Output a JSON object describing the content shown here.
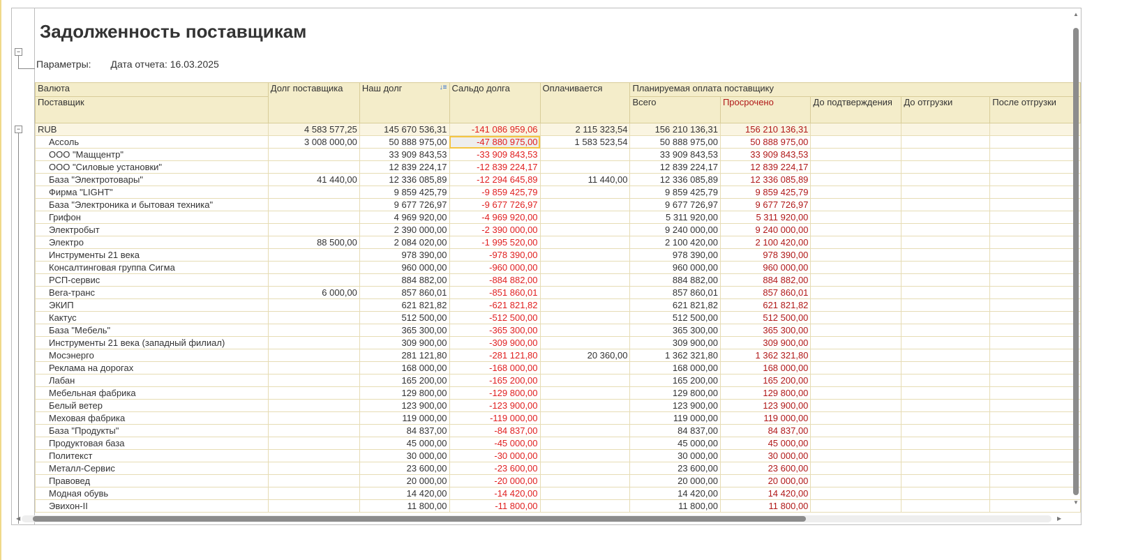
{
  "report": {
    "title": "Задолженность поставщикам",
    "params_label": "Параметры:",
    "params_value": "Дата отчета: 16.03.2025"
  },
  "headers": {
    "currency": "Валюта",
    "supplier": "Поставщик",
    "supplier_debt": "Долг поставщика",
    "our_debt": "Наш долг",
    "balance": "Сальдо долга",
    "paying": "Оплачивается",
    "planned": "Планируемая оплата поставщику",
    "total": "Всего",
    "overdue": "Просрочено",
    "before_confirm": "До подтверждения",
    "before_shipment": "До отгрузки",
    "after_shipment": "После отгрузки"
  },
  "group": {
    "name": "RUB",
    "supplier_debt": "4 583 577,25",
    "our_debt": "145 670 536,31",
    "balance": "-141 086 959,06",
    "paying": "2 115 323,54",
    "total": "156 210 136,31",
    "overdue": "156 210 136,31"
  },
  "rows": [
    [
      "Ассоль",
      "3 008 000,00",
      "50 888 975,00",
      "-47 880 975,00",
      "1 583 523,54",
      "50 888 975,00",
      "50 888 975,00"
    ],
    [
      "ООО \"Мащцентр\"",
      "",
      "33 909 843,53",
      "-33 909 843,53",
      "",
      "33 909 843,53",
      "33 909 843,53"
    ],
    [
      "ООО \"Силовые установки\"",
      "",
      "12 839 224,17",
      "-12 839 224,17",
      "",
      "12 839 224,17",
      "12 839 224,17"
    ],
    [
      "База \"Электротовары\"",
      "41 440,00",
      "12 336 085,89",
      "-12 294 645,89",
      "11 440,00",
      "12 336 085,89",
      "12 336 085,89"
    ],
    [
      "Фирма \"LIGHT\"",
      "",
      "9 859 425,79",
      "-9 859 425,79",
      "",
      "9 859 425,79",
      "9 859 425,79"
    ],
    [
      "База \"Электроника и бытовая техника\"",
      "",
      "9 677 726,97",
      "-9 677 726,97",
      "",
      "9 677 726,97",
      "9 677 726,97"
    ],
    [
      "Грифон",
      "",
      "4 969 920,00",
      "-4 969 920,00",
      "",
      "5 311 920,00",
      "5 311 920,00"
    ],
    [
      "Электробыт",
      "",
      "2 390 000,00",
      "-2 390 000,00",
      "",
      "9 240 000,00",
      "9 240 000,00"
    ],
    [
      "Электро",
      "88 500,00",
      "2 084 020,00",
      "-1 995 520,00",
      "",
      "2 100 420,00",
      "2 100 420,00"
    ],
    [
      "Инструменты 21 века",
      "",
      "978 390,00",
      "-978 390,00",
      "",
      "978 390,00",
      "978 390,00"
    ],
    [
      "Консалтинговая группа Сигма",
      "",
      "960 000,00",
      "-960 000,00",
      "",
      "960 000,00",
      "960 000,00"
    ],
    [
      "РСП-сервис",
      "",
      "884 882,00",
      "-884 882,00",
      "",
      "884 882,00",
      "884 882,00"
    ],
    [
      "Вега-транс",
      "6 000,00",
      "857 860,01",
      "-851 860,01",
      "",
      "857 860,01",
      "857 860,01"
    ],
    [
      "ЭКИП",
      "",
      "621 821,82",
      "-621 821,82",
      "",
      "621 821,82",
      "621 821,82"
    ],
    [
      "Кактус",
      "",
      "512 500,00",
      "-512 500,00",
      "",
      "512 500,00",
      "512 500,00"
    ],
    [
      "База \"Мебель\"",
      "",
      "365 300,00",
      "-365 300,00",
      "",
      "365 300,00",
      "365 300,00"
    ],
    [
      "Инструменты 21 века (западный филиал)",
      "",
      "309 900,00",
      "-309 900,00",
      "",
      "309 900,00",
      "309 900,00"
    ],
    [
      "Мосэнерго",
      "",
      "281 121,80",
      "-281 121,80",
      "20 360,00",
      "1 362 321,80",
      "1 362 321,80"
    ],
    [
      "Реклама на дорогах",
      "",
      "168 000,00",
      "-168 000,00",
      "",
      "168 000,00",
      "168 000,00"
    ],
    [
      "Лабан",
      "",
      "165 200,00",
      "-165 200,00",
      "",
      "165 200,00",
      "165 200,00"
    ],
    [
      "Мебельная фабрика",
      "",
      "129 800,00",
      "-129 800,00",
      "",
      "129 800,00",
      "129 800,00"
    ],
    [
      "Белый ветер",
      "",
      "123 900,00",
      "-123 900,00",
      "",
      "123 900,00",
      "123 900,00"
    ],
    [
      "Меховая фабрика",
      "",
      "119 000,00",
      "-119 000,00",
      "",
      "119 000,00",
      "119 000,00"
    ],
    [
      "База \"Продукты\"",
      "",
      "84 837,00",
      "-84 837,00",
      "",
      "84 837,00",
      "84 837,00"
    ],
    [
      "Продуктовая база",
      "",
      "45 000,00",
      "-45 000,00",
      "",
      "45 000,00",
      "45 000,00"
    ],
    [
      "Политекст",
      "",
      "30 000,00",
      "-30 000,00",
      "",
      "30 000,00",
      "30 000,00"
    ],
    [
      "Металл-Сервис",
      "",
      "23 600,00",
      "-23 600,00",
      "",
      "23 600,00",
      "23 600,00"
    ],
    [
      "Правовед",
      "",
      "20 000,00",
      "-20 000,00",
      "",
      "20 000,00",
      "20 000,00"
    ],
    [
      "Модная обувь",
      "",
      "14 420,00",
      "-14 420,00",
      "",
      "14 420,00",
      "14 420,00"
    ],
    [
      "Эвихон-II",
      "",
      "11 800,00",
      "-11 800,00",
      "",
      "11 800,00",
      "11 800,00"
    ]
  ],
  "colors": {
    "header_bg": "#f4edca",
    "negative": "#e02020",
    "overdue": "#b01818",
    "selection": "#f5c542"
  }
}
